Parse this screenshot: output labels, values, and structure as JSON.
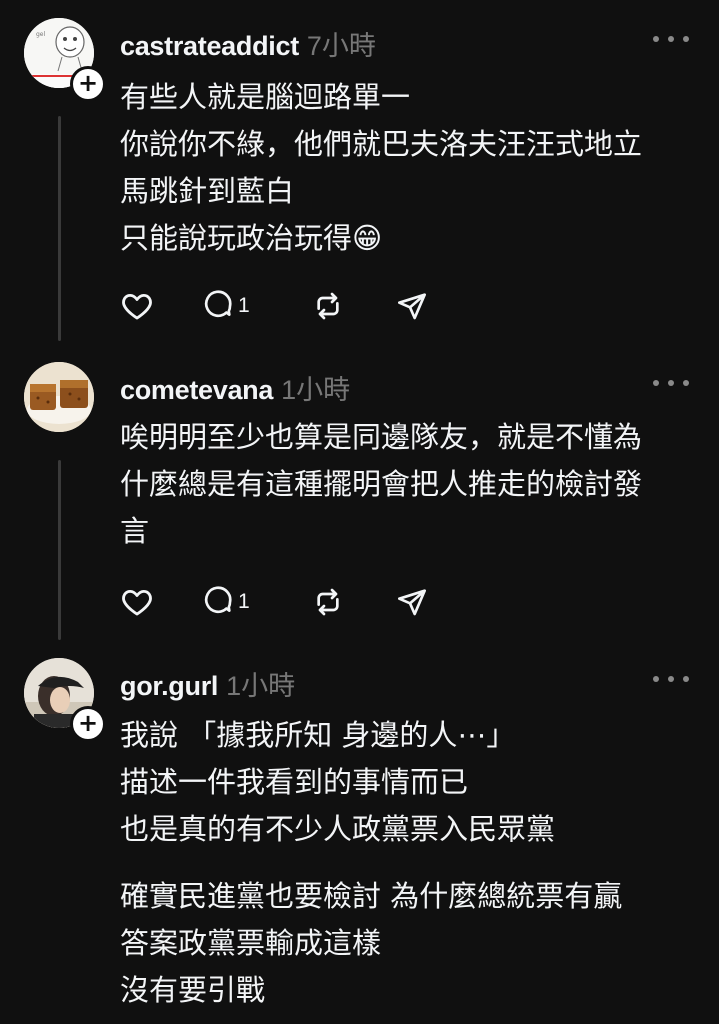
{
  "posts": [
    {
      "username": "castrateaddict",
      "time": "7小時",
      "lines": [
        "有些人就是腦迴路單一",
        "你說你不綠，他們就巴夫洛夫汪汪式地立",
        "馬跳針到藍白",
        "只能說玩政治玩得😁"
      ],
      "reply_count": "1",
      "avatar_icon": "cartoon-face-avatar"
    },
    {
      "username": "cometevana",
      "time": "1小時",
      "lines": [
        "唉明明至少也算是同邊隊友，就是不懂為",
        "什麼總是有這種擺明會把人推走的檢討發",
        "言"
      ],
      "reply_count": "1",
      "avatar_icon": "food-cake-avatar"
    },
    {
      "username": "gor.gurl",
      "time": "1小時",
      "lines": [
        "我說 「據我所知 身邊的人⋯」",
        "描述一件我看到的事情而已",
        "也是真的有不少人政黨票入民眾黨"
      ],
      "lines2": [
        "確實民進黨也要檢討 為什麼總統票有贏",
        "答案政黨票輸成這樣",
        "沒有要引戰"
      ],
      "avatar_icon": "person-cap-avatar"
    }
  ],
  "colors": {
    "background": "#101010",
    "text": "#f3f5f7",
    "muted": "#777777",
    "thread_line": "#3a3a3a"
  }
}
